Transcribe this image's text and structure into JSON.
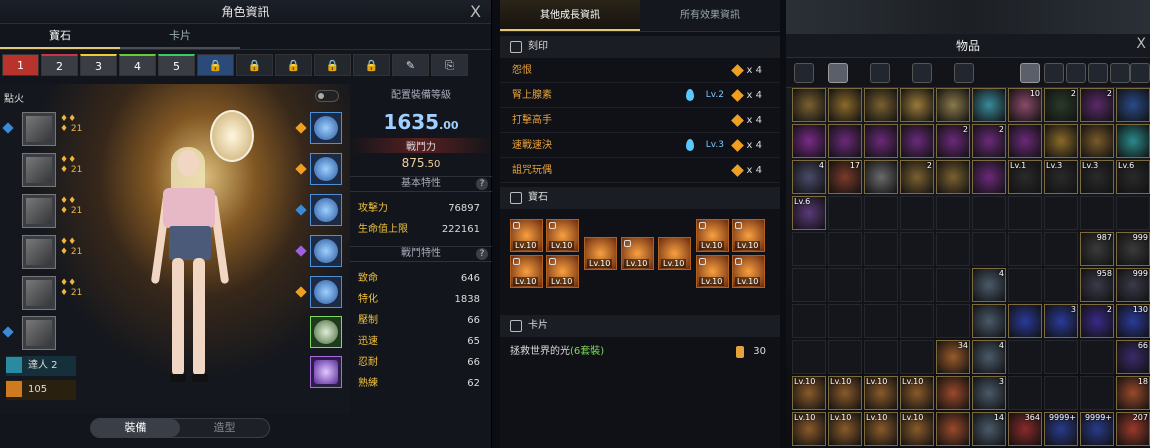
{
  "left": {
    "title": "角色資訊",
    "close": "X",
    "tabs": [
      "寶石",
      "卡片"
    ],
    "preset_slots": [
      "1",
      "2",
      "3",
      "4",
      "5"
    ],
    "preset_colors": [
      "#b8332b",
      "#3a3d44",
      "#3a3d44",
      "#3a3d44",
      "#3a3d44"
    ],
    "ignite_label": "點火",
    "master_label": "達人 2",
    "bonus_value": "105",
    "bottom_tabs": [
      "裝備",
      "造型"
    ],
    "stats": {
      "item_level_header": "配置裝備等級",
      "item_level_main": "1635",
      "item_level_dec": ".00",
      "combat_power_header": "戰鬥力",
      "combat_power_main": "875",
      "combat_power_dec": ".50",
      "basic_header": "基本特性",
      "basic": [
        {
          "k": "攻擊力",
          "v": "76897"
        },
        {
          "k": "生命值上限",
          "v": "222161"
        }
      ],
      "combat_header": "戰鬥特性",
      "combat": [
        {
          "k": "致命",
          "v": "646"
        },
        {
          "k": "特化",
          "v": "1838"
        },
        {
          "k": "壓制",
          "v": "66"
        },
        {
          "k": "迅速",
          "v": "65"
        },
        {
          "k": "忍耐",
          "v": "66"
        },
        {
          "k": "熟練",
          "v": "62"
        }
      ]
    }
  },
  "middle": {
    "tabs": [
      "其他成長資訊",
      "所有效果資訊"
    ],
    "engrave_header": "刻印",
    "engravings": [
      {
        "name": "怨恨",
        "lv": "",
        "count": "x 4"
      },
      {
        "name": "腎上腺素",
        "lv": "Lv.2",
        "count": "x 4"
      },
      {
        "name": "打擊高手",
        "lv": "",
        "count": "x 4"
      },
      {
        "name": "速戰速決",
        "lv": "Lv.3",
        "count": "x 4"
      },
      {
        "name": "詛咒玩偶",
        "lv": "",
        "count": "x 4"
      }
    ],
    "gem_header": "寶石",
    "gem_label": "Lv.10",
    "card_header": "卡片",
    "card_name": "拯救世界的光",
    "card_set": "(6套裝)",
    "card_count": "30"
  },
  "right": {
    "title": "物品",
    "close": "X",
    "item_counts": {
      "a": "10",
      "b": "2",
      "c": "2",
      "d": "2",
      "e": "2",
      "f": "4",
      "g": "17",
      "h": "2",
      "lv1": "Lv.1",
      "lv3": "Lv.3",
      "lv6": "Lv.6",
      "n987": "987",
      "n999": "999",
      "n958": "958",
      "n130": "130",
      "n27": "27",
      "n3": "3",
      "n34": "34",
      "n66": "66",
      "n18": "18",
      "n14": "14",
      "n364": "364",
      "n9999": "9999+",
      "n207": "207",
      "lv10": "Lv.10"
    }
  }
}
